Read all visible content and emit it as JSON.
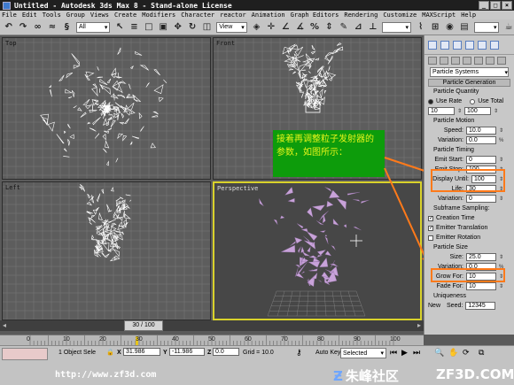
{
  "window": {
    "title": "Untitled - Autodesk 3ds Max 8 - Stand-alone License",
    "controls": [
      "_",
      "□",
      "×"
    ]
  },
  "menu": [
    "File",
    "Edit",
    "Tools",
    "Group",
    "Views",
    "Create",
    "Modifiers",
    "Character",
    "reactor",
    "Animation",
    "Graph Editors",
    "Rendering",
    "Customize",
    "MAXScript",
    "Help"
  ],
  "toolbar": {
    "selection_filter": "All",
    "ref_coord": "View"
  },
  "viewports": {
    "top": "Top",
    "front": "Front",
    "left": "Left",
    "perspective": "Perspective"
  },
  "command_panel": {
    "category": "Particle Systems",
    "rollout": "Particle Generation",
    "particle_quantity": {
      "header": "Particle Quantity",
      "use_rate": "Use Rate",
      "use_total": "Use Total",
      "rate_value": "10",
      "total_value": "100"
    },
    "particle_motion": {
      "header": "Particle Motion",
      "speed_label": "Speed:",
      "speed": "10.0",
      "variation_label": "Variation:",
      "variation": "0.0"
    },
    "particle_timing": {
      "header": "Particle Timing",
      "emit_start_label": "Emit Start:",
      "emit_start": "0",
      "emit_stop_label": "Emit Stop:",
      "emit_stop": "100",
      "display_until_label": "Display Until:",
      "display_until": "100",
      "life_label": "Life:",
      "life": "30",
      "variation_label": "Variation:",
      "variation": "0"
    },
    "subframe": {
      "header": "Subframe Sampling:",
      "creation_time": "Creation Time",
      "emitter_translation": "Emitter Translation",
      "emitter_rotation": "Emitter Rotation"
    },
    "particle_size": {
      "header": "Particle Size",
      "size_label": "Size:",
      "size": "25.0",
      "variation_label": "Variation:",
      "variation": "0.0",
      "grow_for_label": "Grow For:",
      "grow_for": "10",
      "fade_for_label": "Fade For:",
      "fade_for": "10"
    },
    "uniqueness": {
      "header": "Uniqueness",
      "new_label": "New",
      "seed_label": "Seed:",
      "seed": "12345"
    }
  },
  "annotation": {
    "text": "接着再调整粒子发射器的参数，如图所示："
  },
  "timeline": {
    "frame_display": "30 / 100",
    "ticks": [
      "0",
      "10",
      "20",
      "30",
      "40",
      "50",
      "60",
      "70",
      "80",
      "90",
      "100"
    ]
  },
  "status": {
    "selected_count": "1 Object Sele",
    "x_val": "31.986",
    "y_val": "-11.986",
    "z_val": "0.0",
    "grid": "Grid = 10.0",
    "auto_key": "Auto Key",
    "key_mode": "Selected"
  },
  "watermark": {
    "url": "http://www.zf3d.com",
    "cn": "朱峰社区",
    "en": "ZF3D.COM"
  }
}
